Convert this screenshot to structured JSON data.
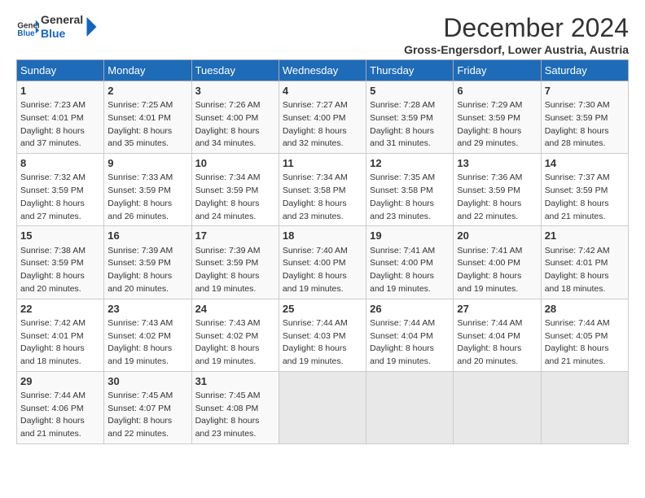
{
  "header": {
    "logo_line1": "General",
    "logo_line2": "Blue",
    "month_title": "December 2024",
    "subtitle": "Gross-Engersdorf, Lower Austria, Austria"
  },
  "weekdays": [
    "Sunday",
    "Monday",
    "Tuesday",
    "Wednesday",
    "Thursday",
    "Friday",
    "Saturday"
  ],
  "weeks": [
    [
      {
        "day": "1",
        "sunrise": "7:23 AM",
        "sunset": "4:01 PM",
        "daylight": "8 hours and 37 minutes."
      },
      {
        "day": "2",
        "sunrise": "7:25 AM",
        "sunset": "4:01 PM",
        "daylight": "8 hours and 35 minutes."
      },
      {
        "day": "3",
        "sunrise": "7:26 AM",
        "sunset": "4:00 PM",
        "daylight": "8 hours and 34 minutes."
      },
      {
        "day": "4",
        "sunrise": "7:27 AM",
        "sunset": "4:00 PM",
        "daylight": "8 hours and 32 minutes."
      },
      {
        "day": "5",
        "sunrise": "7:28 AM",
        "sunset": "3:59 PM",
        "daylight": "8 hours and 31 minutes."
      },
      {
        "day": "6",
        "sunrise": "7:29 AM",
        "sunset": "3:59 PM",
        "daylight": "8 hours and 29 minutes."
      },
      {
        "day": "7",
        "sunrise": "7:30 AM",
        "sunset": "3:59 PM",
        "daylight": "8 hours and 28 minutes."
      }
    ],
    [
      {
        "day": "8",
        "sunrise": "7:32 AM",
        "sunset": "3:59 PM",
        "daylight": "8 hours and 27 minutes."
      },
      {
        "day": "9",
        "sunrise": "7:33 AM",
        "sunset": "3:59 PM",
        "daylight": "8 hours and 26 minutes."
      },
      {
        "day": "10",
        "sunrise": "7:34 AM",
        "sunset": "3:59 PM",
        "daylight": "8 hours and 24 minutes."
      },
      {
        "day": "11",
        "sunrise": "7:34 AM",
        "sunset": "3:58 PM",
        "daylight": "8 hours and 23 minutes."
      },
      {
        "day": "12",
        "sunrise": "7:35 AM",
        "sunset": "3:58 PM",
        "daylight": "8 hours and 23 minutes."
      },
      {
        "day": "13",
        "sunrise": "7:36 AM",
        "sunset": "3:59 PM",
        "daylight": "8 hours and 22 minutes."
      },
      {
        "day": "14",
        "sunrise": "7:37 AM",
        "sunset": "3:59 PM",
        "daylight": "8 hours and 21 minutes."
      }
    ],
    [
      {
        "day": "15",
        "sunrise": "7:38 AM",
        "sunset": "3:59 PM",
        "daylight": "8 hours and 20 minutes."
      },
      {
        "day": "16",
        "sunrise": "7:39 AM",
        "sunset": "3:59 PM",
        "daylight": "8 hours and 20 minutes."
      },
      {
        "day": "17",
        "sunrise": "7:39 AM",
        "sunset": "3:59 PM",
        "daylight": "8 hours and 19 minutes."
      },
      {
        "day": "18",
        "sunrise": "7:40 AM",
        "sunset": "4:00 PM",
        "daylight": "8 hours and 19 minutes."
      },
      {
        "day": "19",
        "sunrise": "7:41 AM",
        "sunset": "4:00 PM",
        "daylight": "8 hours and 19 minutes."
      },
      {
        "day": "20",
        "sunrise": "7:41 AM",
        "sunset": "4:00 PM",
        "daylight": "8 hours and 19 minutes."
      },
      {
        "day": "21",
        "sunrise": "7:42 AM",
        "sunset": "4:01 PM",
        "daylight": "8 hours and 18 minutes."
      }
    ],
    [
      {
        "day": "22",
        "sunrise": "7:42 AM",
        "sunset": "4:01 PM",
        "daylight": "8 hours and 18 minutes."
      },
      {
        "day": "23",
        "sunrise": "7:43 AM",
        "sunset": "4:02 PM",
        "daylight": "8 hours and 19 minutes."
      },
      {
        "day": "24",
        "sunrise": "7:43 AM",
        "sunset": "4:02 PM",
        "daylight": "8 hours and 19 minutes."
      },
      {
        "day": "25",
        "sunrise": "7:44 AM",
        "sunset": "4:03 PM",
        "daylight": "8 hours and 19 minutes."
      },
      {
        "day": "26",
        "sunrise": "7:44 AM",
        "sunset": "4:04 PM",
        "daylight": "8 hours and 19 minutes."
      },
      {
        "day": "27",
        "sunrise": "7:44 AM",
        "sunset": "4:04 PM",
        "daylight": "8 hours and 20 minutes."
      },
      {
        "day": "28",
        "sunrise": "7:44 AM",
        "sunset": "4:05 PM",
        "daylight": "8 hours and 21 minutes."
      }
    ],
    [
      {
        "day": "29",
        "sunrise": "7:44 AM",
        "sunset": "4:06 PM",
        "daylight": "8 hours and 21 minutes."
      },
      {
        "day": "30",
        "sunrise": "7:45 AM",
        "sunset": "4:07 PM",
        "daylight": "8 hours and 22 minutes."
      },
      {
        "day": "31",
        "sunrise": "7:45 AM",
        "sunset": "4:08 PM",
        "daylight": "8 hours and 23 minutes."
      },
      null,
      null,
      null,
      null
    ]
  ]
}
